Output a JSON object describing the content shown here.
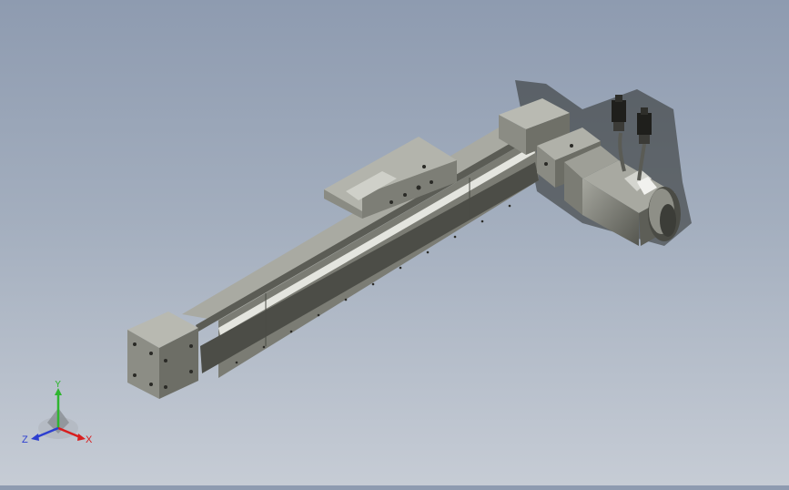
{
  "viewport": {
    "background_top": "#8e9bb0",
    "background_bottom": "#c6ccd5",
    "model_color": "#8e8f86",
    "model_shadow": "#3f403b"
  },
  "triad": {
    "x_label": "X",
    "y_label": "Y",
    "z_label": "Z",
    "x_color": "#d81e1e",
    "y_color": "#2fb52f",
    "z_color": "#2d3fd0"
  }
}
